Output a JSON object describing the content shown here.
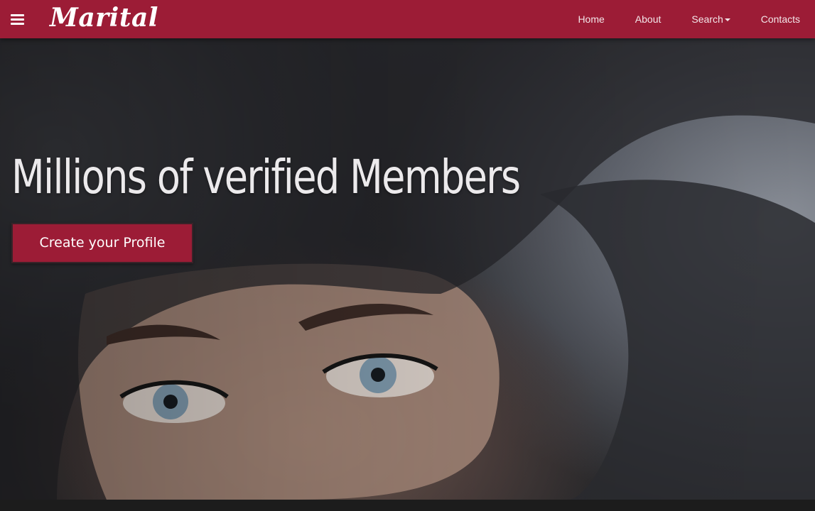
{
  "header": {
    "brand": "Marital",
    "menu_icon": "hamburger-menu-icon",
    "nav": {
      "home": "Home",
      "about": "About",
      "search": "Search",
      "contacts": "Contacts"
    }
  },
  "hero": {
    "title": "Millions of verified Members",
    "cta_label": "Create your Profile"
  },
  "colors": {
    "brand": "#9c1c36",
    "nav_text": "#f3e6e9",
    "hero_text": "#eceaec",
    "footer": "#1c1c1c"
  }
}
